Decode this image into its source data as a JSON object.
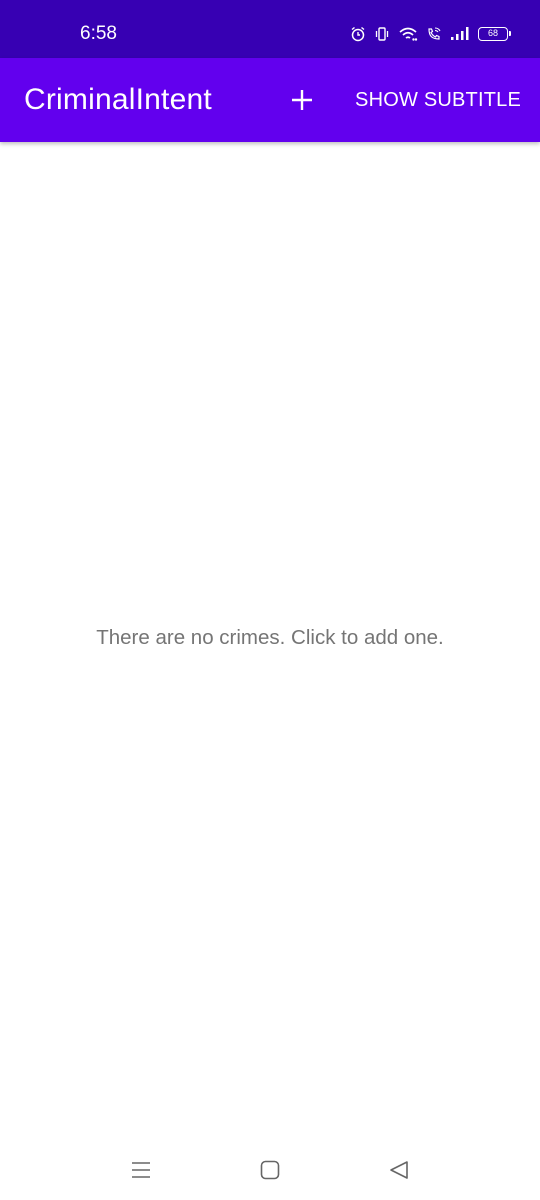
{
  "status_bar": {
    "time": "6:58",
    "battery": "68",
    "icons": [
      "alarm-icon",
      "vibrate-icon",
      "wifi-icon",
      "wifi-calling-icon",
      "signal-icon",
      "battery-icon"
    ]
  },
  "app_bar": {
    "title": "CriminalIntent",
    "add_icon": "plus-icon",
    "subtitle_label": "SHOW SUBTITLE"
  },
  "main": {
    "empty_message": "There are no crimes. Click to add one."
  },
  "nav_bar": {
    "buttons": [
      "menu-icon",
      "home-icon",
      "back-icon"
    ]
  },
  "colors": {
    "status_bar": "#3700b3",
    "app_bar": "#6200ee",
    "background": "#ffffff",
    "message_text": "#757575"
  }
}
